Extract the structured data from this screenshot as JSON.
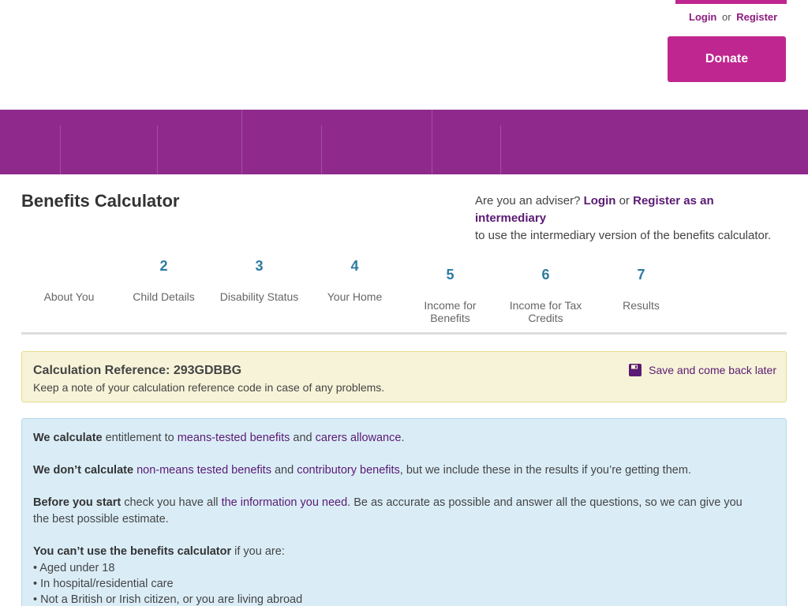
{
  "header": {
    "login": "Login",
    "or": "or",
    "register": "Register",
    "donate": "Donate"
  },
  "page": {
    "title": "Benefits Calculator"
  },
  "adviser": {
    "prefix": "Are you an adviser?",
    "login": "Login",
    "or": "or",
    "register": "Register as an intermediary",
    "suffix": "to use the intermediary version of the benefits calculator."
  },
  "steps": [
    {
      "num": "",
      "label": "About You"
    },
    {
      "num": "2",
      "label": "Child Details"
    },
    {
      "num": "3",
      "label": "Disability Status"
    },
    {
      "num": "4",
      "label": "Your Home"
    },
    {
      "num": "5",
      "label": "Income for Benefits"
    },
    {
      "num": "6",
      "label": "Income for Tax Credits"
    },
    {
      "num": "7",
      "label": "Results"
    }
  ],
  "reference": {
    "title": "Calculation Reference: 293GDBBG",
    "note": "Keep a note of your calculation reference code in case of any problems.",
    "save": "Save and come back later"
  },
  "info": {
    "p1": {
      "bold": "We calculate",
      "text1": " entitlement to ",
      "link1": "means-tested benefits",
      "text2": " and ",
      "link2": "carers allowance",
      "text3": "."
    },
    "p2": {
      "bold": "We don’t calculate",
      "text1": " ",
      "link1": "non-means tested benefits",
      "text2": " and ",
      "link2": "contributory benefits",
      "text3": ", but we include these in the results if you’re getting them."
    },
    "p3": {
      "bold": "Before you start",
      "text1": " check you have all ",
      "link1": "the information you need",
      "text2": ". Be as accurate as possible and answer all the questions, so we can give you the best possible estimate."
    },
    "p4": {
      "bold": "You can’t use the benefits calculator",
      "text1": " if you are:"
    },
    "bullets": [
      "• Aged under 18",
      "• In hospital/residential care",
      "• Not a British or Irish citizen, or you are living abroad"
    ]
  }
}
